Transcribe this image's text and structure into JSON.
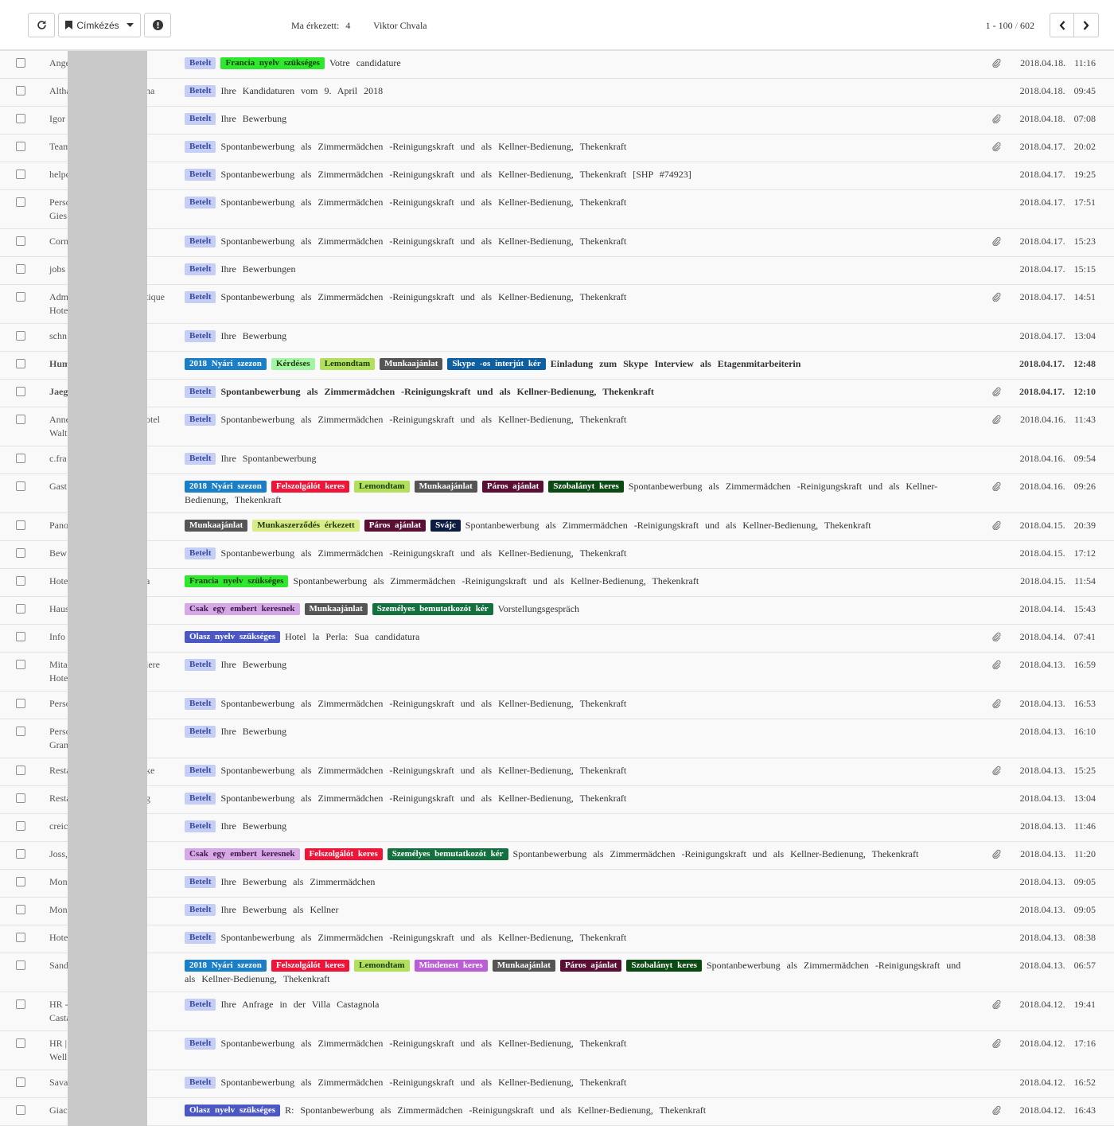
{
  "toolbar": {
    "label_button": "Címkézés",
    "today_label": "Ma érkezett:",
    "today_count": "4",
    "user_name": "Viktor Chvala",
    "page_range": "1 - 100",
    "page_sep": "/",
    "page_total": "602"
  },
  "colors": {
    "Betelt": "#c5cff5",
    "Francia nyelv szükséges": "#2ee82e",
    "2018 Nyári szezon": "#1a7fc6",
    "Kérdéses": "#a3f5a3",
    "Lemondtam": "#b2e05c",
    "Munkaajánlat": "#555555",
    "Skype -os interjút kér": "#0e5fa0",
    "Felszolgálót keres": "#ef1538",
    "Páros ajánlat": "#5c0f35",
    "Szobalányt keres": "#0b4a12",
    "Munkaszerződés érkezett": "#d9ec88",
    "Svájc": "#0c1c42",
    "Csak egy embert keresnek": "#d6a8e6",
    "Személyes bemutatkozót kér": "#157040",
    "Olasz nyelv szükséges": "#4b57c5",
    "Mindenest keres": "#bb5ed6"
  },
  "rows": [
    {
      "s1": "Ange",
      "s2": "",
      "sfx": "",
      "tags": [
        "Betelt",
        "Francia nyelv szükséges"
      ],
      "subject": "Votre candidature",
      "clip": true,
      "date": "2018.04.18.",
      "time": "11:16",
      "bold": false
    },
    {
      "s1": "Altha",
      "s2": "",
      "sfx": "na",
      "tags": [
        "Betelt"
      ],
      "subject": "Ihre Kandidaturen vom 9. April 2018",
      "clip": false,
      "date": "2018.04.18.",
      "time": "09:45",
      "bold": false
    },
    {
      "s1": "Igor",
      "s2": "",
      "sfx": "",
      "tags": [
        "Betelt"
      ],
      "subject": "Ihre Bewerbung",
      "clip": true,
      "date": "2018.04.18.",
      "time": "07:08",
      "bold": false
    },
    {
      "s1": "Team",
      "s2": "",
      "sfx": "",
      "tags": [
        "Betelt"
      ],
      "subject": "Spontanbewerbung als Zimmermädchen -Reinigungskraft und als Kellner-Bedienung, Thekenkraft",
      "clip": true,
      "date": "2018.04.17.",
      "time": "20:02",
      "bold": false
    },
    {
      "s1": "helpc",
      "s2": "",
      "sfx": "",
      "tags": [
        "Betelt"
      ],
      "subject": "Spontanbewerbung als Zimmermädchen -Reinigungskraft und als Kellner-Bedienung, Thekenkraft [SHP #74923]",
      "clip": false,
      "date": "2018.04.17.",
      "time": "19:25",
      "bold": false
    },
    {
      "s1": "Perso",
      "s2": "Gies",
      "sfx": "",
      "tags": [
        "Betelt"
      ],
      "subject": "Spontanbewerbung als Zimmermädchen -Reinigungskraft und als Kellner-Bedienung, Thekenkraft",
      "clip": false,
      "date": "2018.04.17.",
      "time": "17:51",
      "bold": false
    },
    {
      "s1": "Corn",
      "s2": "",
      "sfx": "",
      "tags": [
        "Betelt"
      ],
      "subject": "Spontanbewerbung als Zimmermädchen -Reinigungskraft und als Kellner-Bedienung, Thekenkraft",
      "clip": true,
      "date": "2018.04.17.",
      "time": "15:23",
      "bold": false
    },
    {
      "s1": "jobs",
      "s2": "",
      "sfx": "",
      "tags": [
        "Betelt"
      ],
      "subject": "Ihre Bewerbungen",
      "clip": false,
      "date": "2018.04.17.",
      "time": "15:15",
      "bold": false
    },
    {
      "s1": "Adm",
      "s2": "Hote",
      "sfx": "tique",
      "tags": [
        "Betelt"
      ],
      "subject": "Spontanbewerbung als Zimmermädchen -Reinigungskraft und als Kellner-Bedienung, Thekenkraft",
      "clip": true,
      "date": "2018.04.17.",
      "time": "14:51",
      "bold": false
    },
    {
      "s1": "schn",
      "s2": "",
      "sfx": "",
      "tags": [
        "Betelt"
      ],
      "subject": "Ihre Bewerbung",
      "clip": false,
      "date": "2018.04.17.",
      "time": "13:04",
      "bold": false
    },
    {
      "s1": "Hum",
      "s2": "",
      "sfx": "",
      "tags": [
        "2018 Nyári szezon",
        "Kérdéses",
        "Lemondtam",
        "Munkaajánlat",
        "Skype -os interjút kér"
      ],
      "subject": "Einladung zum Skype Interview als Etagenmitarbeiterin",
      "clip": false,
      "date": "2018.04.17.",
      "time": "12:48",
      "bold": true
    },
    {
      "s1": "Jaeg",
      "s2": "",
      "sfx": "",
      "tags": [
        "Betelt"
      ],
      "subject": "Spontanbewerbung als Zimmermädchen -Reinigungskraft und als Kellner-Bedienung, Thekenkraft",
      "clip": true,
      "date": "2018.04.17.",
      "time": "12:10",
      "bold": true
    },
    {
      "s1": "Anne",
      "s2": "Walt",
      "sfx": "otel",
      "tags": [
        "Betelt"
      ],
      "subject": "Spontanbewerbung als Zimmermädchen -Reinigungskraft und als Kellner-Bedienung, Thekenkraft",
      "clip": true,
      "date": "2018.04.16.",
      "time": "11:43",
      "bold": false
    },
    {
      "s1": "c.fra",
      "s2": "",
      "sfx": "",
      "tags": [
        "Betelt"
      ],
      "subject": "Ihre Spontanbewerbung",
      "clip": false,
      "date": "2018.04.16.",
      "time": "09:54",
      "bold": false
    },
    {
      "s1": "Gast",
      "s2": "",
      "sfx": "",
      "tags": [
        "2018 Nyári szezon",
        "Felszolgálót keres",
        "Lemondtam",
        "Munkaajánlat",
        "Páros ajánlat",
        "Szobalányt keres"
      ],
      "subject": "Spontanbewerbung als Zimmermädchen -Reinigungskraft und als Kellner-Bedienung, Thekenkraft",
      "clip": true,
      "date": "2018.04.16.",
      "time": "09:26",
      "bold": false
    },
    {
      "s1": "Pano",
      "s2": "",
      "sfx": "",
      "tags": [
        "Munkaajánlat",
        "Munkaszerződés érkezett",
        "Páros ajánlat",
        "Svájc"
      ],
      "subject": "Spontanbewerbung als Zimmermädchen -Reinigungskraft und als Kellner-Bedienung, Thekenkraft",
      "clip": true,
      "date": "2018.04.15.",
      "time": "20:39",
      "bold": false
    },
    {
      "s1": "Bew",
      "s2": "",
      "sfx": "",
      "tags": [
        "Betelt"
      ],
      "subject": "Spontanbewerbung als Zimmermädchen -Reinigungskraft und als Kellner-Bedienung, Thekenkraft",
      "clip": false,
      "date": "2018.04.15.",
      "time": "17:12",
      "bold": false
    },
    {
      "s1": "Hote",
      "s2": "",
      "sfx": "a",
      "tags": [
        "Francia nyelv szükséges"
      ],
      "subject": "Spontanbewerbung als Zimmermädchen -Reinigungskraft und als Kellner-Bedienung, Thekenkraft",
      "clip": false,
      "date": "2018.04.15.",
      "time": "11:54",
      "bold": false
    },
    {
      "s1": "Haus",
      "s2": "",
      "sfx": "",
      "tags": [
        "Csak egy embert keresnek",
        "Munkaajánlat",
        "Személyes bemutatkozót kér"
      ],
      "subject": "Vorstellungsgespräch",
      "clip": false,
      "date": "2018.04.14.",
      "time": "15:43",
      "bold": false
    },
    {
      "s1": "Info",
      "s2": "",
      "sfx": "",
      "tags": [
        "Olasz nyelv szükséges"
      ],
      "subject": "Hotel la Perla: Sua candidatura",
      "clip": true,
      "date": "2018.04.14.",
      "time": "07:41",
      "bold": false
    },
    {
      "s1": "Mita",
      "s2": "Hote",
      "sfx": "lere",
      "tags": [
        "Betelt"
      ],
      "subject": "Ihre Bewerbung",
      "clip": true,
      "date": "2018.04.13.",
      "time": "16:59",
      "bold": false
    },
    {
      "s1": "Perso",
      "s2": "",
      "sfx": "",
      "tags": [
        "Betelt"
      ],
      "subject": "Spontanbewerbung als Zimmermädchen -Reinigungskraft und als Kellner-Bedienung, Thekenkraft",
      "clip": true,
      "date": "2018.04.13.",
      "time": "16:53",
      "bold": false
    },
    {
      "s1": "Perso",
      "s2": "Gran",
      "sfx": "",
      "tags": [
        "Betelt"
      ],
      "subject": "Ihre Bewerbung",
      "clip": false,
      "date": "2018.04.13.",
      "time": "16:10",
      "bold": false
    },
    {
      "s1": "Resta",
      "s2": "",
      "sfx": "ke",
      "tags": [
        "Betelt"
      ],
      "subject": "Spontanbewerbung als Zimmermädchen -Reinigungskraft und als Kellner-Bedienung, Thekenkraft",
      "clip": true,
      "date": "2018.04.13.",
      "time": "15:25",
      "bold": false
    },
    {
      "s1": "Resta",
      "s2": "",
      "sfx": "g",
      "tags": [
        "Betelt"
      ],
      "subject": "Spontanbewerbung als Zimmermädchen -Reinigungskraft und als Kellner-Bedienung, Thekenkraft",
      "clip": false,
      "date": "2018.04.13.",
      "time": "13:04",
      "bold": false
    },
    {
      "s1": "creic",
      "s2": "",
      "sfx": "",
      "tags": [
        "Betelt"
      ],
      "subject": "Ihre Bewerbung",
      "clip": false,
      "date": "2018.04.13.",
      "time": "11:46",
      "bold": false
    },
    {
      "s1": "Joss,",
      "s2": "",
      "sfx": "",
      "tags": [
        "Csak egy embert keresnek",
        "Felszolgálót keres",
        "Személyes bemutatkozót kér"
      ],
      "subject": "Spontanbewerbung als Zimmermädchen -Reinigungskraft und als Kellner-Bedienung, Thekenkraft",
      "clip": true,
      "date": "2018.04.13.",
      "time": "11:20",
      "bold": false
    },
    {
      "s1": "Mon",
      "s2": "",
      "sfx": "",
      "tags": [
        "Betelt"
      ],
      "subject": "Ihre Bewerbung als Zimmermädchen",
      "clip": false,
      "date": "2018.04.13.",
      "time": "09:05",
      "bold": false
    },
    {
      "s1": "Mon",
      "s2": "",
      "sfx": "",
      "tags": [
        "Betelt"
      ],
      "subject": "Ihre Bewerbung als Kellner",
      "clip": false,
      "date": "2018.04.13.",
      "time": "09:05",
      "bold": false
    },
    {
      "s1": "Hote",
      "s2": "",
      "sfx": "",
      "tags": [
        "Betelt"
      ],
      "subject": "Spontanbewerbung als Zimmermädchen -Reinigungskraft und als Kellner-Bedienung, Thekenkraft",
      "clip": false,
      "date": "2018.04.13.",
      "time": "08:38",
      "bold": false
    },
    {
      "s1": "Sand",
      "s2": "",
      "sfx": "",
      "tags": [
        "2018 Nyári szezon",
        "Felszolgálót keres",
        "Lemondtam",
        "Mindenest keres",
        "Munkaajánlat",
        "Páros ajánlat",
        "Szobalányt keres"
      ],
      "subject": "Spontanbewerbung als Zimmermädchen -Reinigungskraft und als Kellner-Bedienung, Thekenkraft",
      "clip": false,
      "date": "2018.04.13.",
      "time": "06:57",
      "bold": false
    },
    {
      "s1": "HR -",
      "s2": "Casta",
      "sfx": "",
      "tags": [
        "Betelt"
      ],
      "subject": "Ihre Anfrage in der Villa Castagnola",
      "clip": true,
      "date": "2018.04.12.",
      "time": "19:41",
      "bold": false
    },
    {
      "s1": "HR |",
      "s2": "Well",
      "sfx": "",
      "tags": [
        "Betelt"
      ],
      "subject": "Spontanbewerbung als Zimmermädchen -Reinigungskraft und als Kellner-Bedienung, Thekenkraft",
      "clip": true,
      "date": "2018.04.12.",
      "time": "17:16",
      "bold": false
    },
    {
      "s1": "Sava",
      "s2": "",
      "sfx": "",
      "tags": [
        "Betelt"
      ],
      "subject": "Spontanbewerbung als Zimmermädchen -Reinigungskraft und als Kellner-Bedienung, Thekenkraft",
      "clip": false,
      "date": "2018.04.12.",
      "time": "16:52",
      "bold": false
    },
    {
      "s1": "Giac",
      "s2": "",
      "sfx": "",
      "tags": [
        "Olasz nyelv szükséges"
      ],
      "subject": "R: Spontanbewerbung als Zimmermädchen -Reinigungskraft und als Kellner-Bedienung, Thekenkraft",
      "clip": true,
      "date": "2018.04.12.",
      "time": "16:43",
      "bold": false
    }
  ]
}
